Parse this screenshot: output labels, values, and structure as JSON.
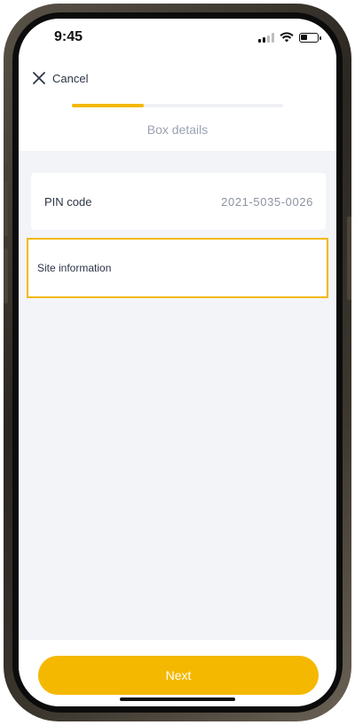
{
  "status_bar": {
    "time": "9:45",
    "signal_bars_active": 2,
    "signal_bars_total": 4,
    "battery_level": 0.4,
    "icons": [
      "cellular-signal-icon",
      "wifi-icon",
      "battery-icon"
    ]
  },
  "header": {
    "cancel_label": "Cancel",
    "cancel_icon": "close-icon",
    "progress_fraction": 0.34,
    "step_title": "Box details"
  },
  "form": {
    "pin_label": "PIN code",
    "pin_value": "2021-5035-0026",
    "site_label": "Site information"
  },
  "footer": {
    "next_label": "Next"
  },
  "colors": {
    "accent": "#f5b800",
    "background": "#f2f4f8",
    "text_primary": "#2c3446",
    "text_secondary": "#9aa2b0"
  }
}
